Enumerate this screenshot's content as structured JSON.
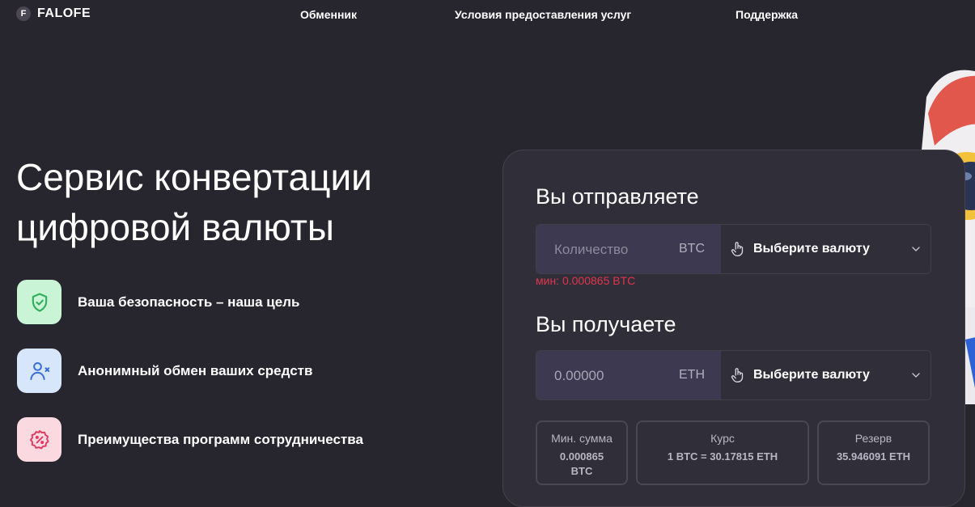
{
  "brand": {
    "logo_letter": "F",
    "name": "FALOFE"
  },
  "nav": {
    "exchanger": "Обменник",
    "terms": "Условия предоставления услуг",
    "support": "Поддержка"
  },
  "hero": {
    "title": "Сервис конвертации цифровой валюты",
    "features": [
      {
        "label": "Ваша безопасность – наша цель",
        "icon": "shield-check-icon",
        "color": "#c9f4d6"
      },
      {
        "label": "Анонимный обмен ваших средств",
        "icon": "user-x-icon",
        "color": "#d8e6fb"
      },
      {
        "label": "Преимущества программ сотрудничества",
        "icon": "percent-badge-icon",
        "color": "#fbd9e1"
      }
    ]
  },
  "exchange": {
    "send": {
      "heading": "Вы отправляете",
      "placeholder": "Количество",
      "currency": "BTC",
      "select_label": "Выберите валюту",
      "min_note": "мин: 0.000865 BTC"
    },
    "receive": {
      "heading": "Вы получаете",
      "value": "0.00000",
      "currency": "ETH",
      "select_label": "Выберите валюту"
    },
    "stats": [
      {
        "label": "Мин. сумма",
        "value_line1": "0.000865",
        "value_line2": "BTC"
      },
      {
        "label": "Курс",
        "value_line1": "1 BTC = 30.17815 ETH"
      },
      {
        "label": "Резерв",
        "value_line1": "35.946091 ETH"
      }
    ]
  },
  "colors": {
    "background": "#27252e",
    "card": "#302e39",
    "error": "#e0354d",
    "green_icon": "#2fae5b",
    "blue_icon": "#3b6fd6",
    "pink_icon": "#e0355f"
  }
}
